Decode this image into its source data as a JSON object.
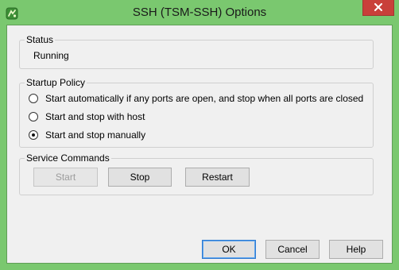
{
  "window": {
    "title": "SSH (TSM-SSH) Options",
    "icon": "vsphere-app-icon",
    "close_icon": "close-icon"
  },
  "status": {
    "legend": "Status",
    "value": "Running"
  },
  "startup_policy": {
    "legend": "Startup Policy",
    "options": [
      {
        "label": "Start automatically if any ports are open, and stop when all ports are closed",
        "selected": false
      },
      {
        "label": "Start and stop with host",
        "selected": false
      },
      {
        "label": "Start and stop manually",
        "selected": true
      }
    ]
  },
  "service_commands": {
    "legend": "Service Commands",
    "start_label": "Start",
    "stop_label": "Stop",
    "restart_label": "Restart"
  },
  "footer": {
    "ok_label": "OK",
    "cancel_label": "Cancel",
    "help_label": "Help"
  },
  "colors": {
    "titlebar": "#7ac86f",
    "close_button": "#c9403a",
    "dialog_background": "#f0f0f0"
  }
}
